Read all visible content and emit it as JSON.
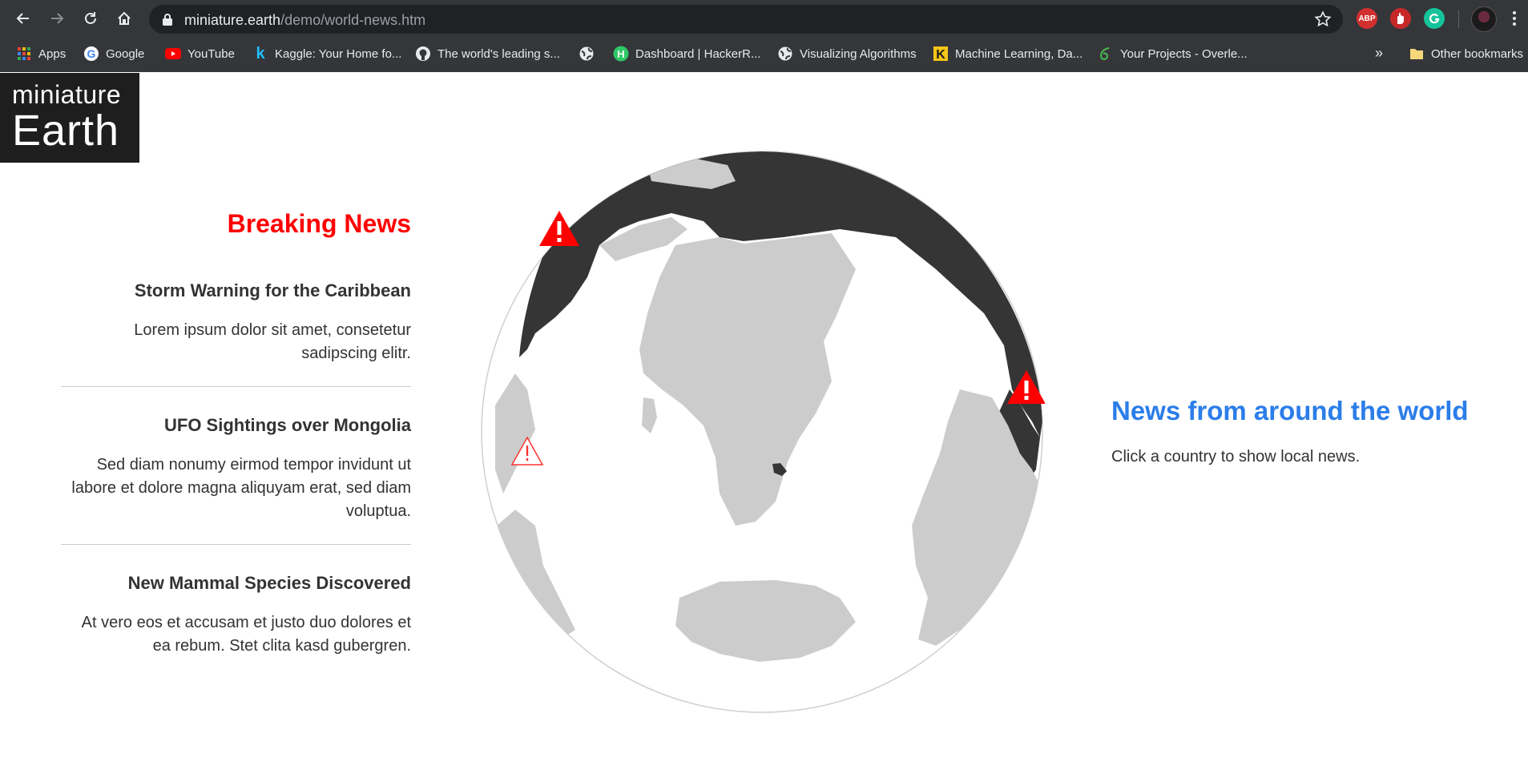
{
  "browser": {
    "url_host": "miniature.earth",
    "url_path": "/demo/world-news.htm",
    "extensions": {
      "abp_label": "ABP"
    },
    "bookmarks": [
      {
        "label": "Apps",
        "icon": "apps-grid-icon"
      },
      {
        "label": "Google",
        "icon": "google-icon"
      },
      {
        "label": "YouTube",
        "icon": "youtube-icon"
      },
      {
        "label": "Kaggle: Your Home fo...",
        "icon": "kaggle-icon"
      },
      {
        "label": "The world's leading s...",
        "icon": "github-icon"
      },
      {
        "label": "",
        "icon": "globe-icon"
      },
      {
        "label": "Dashboard | HackerR...",
        "icon": "hackerrank-icon"
      },
      {
        "label": "Visualizing Algorithms",
        "icon": "globe-icon"
      },
      {
        "label": "Machine Learning, Da...",
        "icon": "kdnuggets-icon"
      },
      {
        "label": "Your Projects - Overle...",
        "icon": "overleaf-icon"
      }
    ],
    "more_bookmarks": "»",
    "other_bookmarks": "Other bookmarks"
  },
  "logo": {
    "line1": "miniature",
    "line2": "Earth"
  },
  "breaking": {
    "heading": "Breaking News",
    "items": [
      {
        "title": "Storm Warning for the Caribbean",
        "body": "Lorem ipsum dolor sit amet, consetetur sadipscing elitr."
      },
      {
        "title": "UFO Sightings over Mongolia",
        "body": "Sed diam nonumy eirmod tempor invidunt ut labore et dolore magna aliquyam erat, sed diam voluptua."
      },
      {
        "title": "New Mammal Species Discovered",
        "body": "At vero eos et accusam et justo duo dolores et ea rebum. Stet clita kasd gubergren."
      }
    ]
  },
  "globe": {
    "colors": {
      "land": "#cccccc",
      "highlight": "#353535",
      "ocean": "#ffffff",
      "marker": "#ff0000"
    },
    "markers": [
      "warning-marker",
      "warning-marker",
      "warning-marker-outline"
    ]
  },
  "world": {
    "heading": "News from around the world",
    "subtitle": "Click a country to show local news."
  }
}
